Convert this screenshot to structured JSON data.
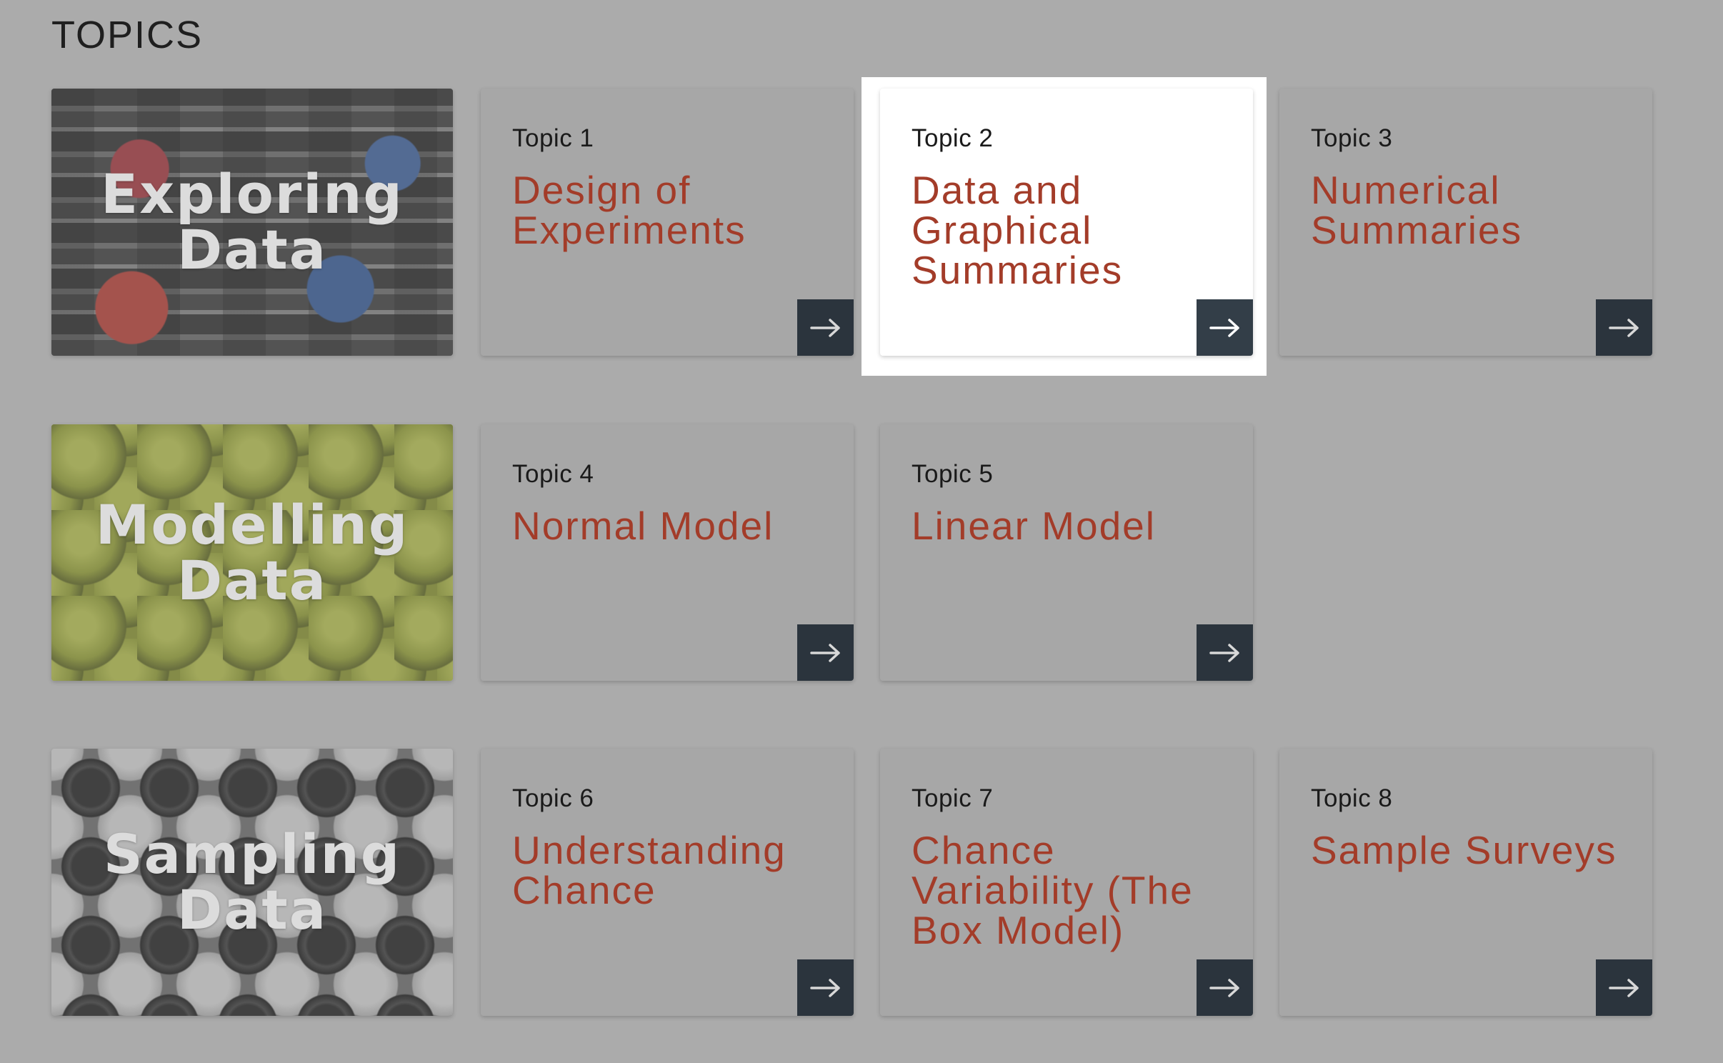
{
  "heading": "TOPICS",
  "sections": [
    {
      "title_line1": "Exploring",
      "title_line2": "Data"
    },
    {
      "title_line1": "Modelling",
      "title_line2": "Data"
    },
    {
      "title_line1": "Sampling",
      "title_line2": "Data"
    }
  ],
  "topics": [
    {
      "label": "Topic 1",
      "title": "Design of Experiments"
    },
    {
      "label": "Topic 2",
      "title": "Data and Graphical Summaries",
      "active": true
    },
    {
      "label": "Topic 3",
      "title": "Numerical Summaries"
    },
    {
      "label": "Topic 4",
      "title": "Normal Model"
    },
    {
      "label": "Topic 5",
      "title": "Linear Model"
    },
    {
      "label": "Topic 6",
      "title": "Understanding Chance"
    },
    {
      "label": "Topic 7",
      "title": "Chance Variability (The Box Model)"
    },
    {
      "label": "Topic 8",
      "title": "Sample Surveys"
    }
  ],
  "icons": {
    "card_button": "arrow-right-icon"
  },
  "colors": {
    "background": "#ababab",
    "title_accent": "#a33c29",
    "button": "#2b343d"
  }
}
